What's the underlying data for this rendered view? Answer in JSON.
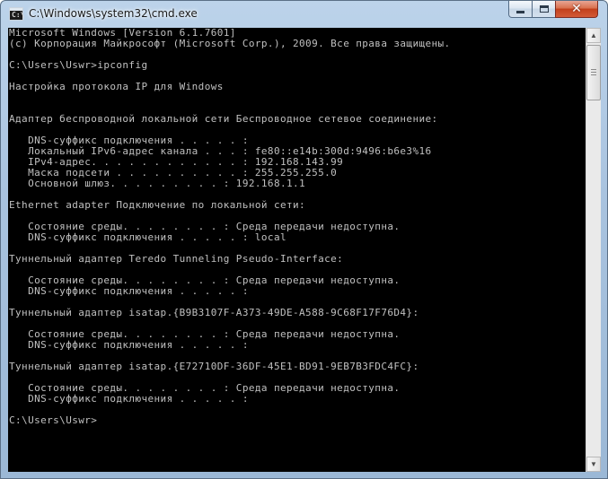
{
  "window": {
    "title": "C:\\Windows\\system32\\cmd.exe",
    "icon": "cmd-icon"
  },
  "controls": {
    "minimize_icon": "minimize-icon",
    "maximize_icon": "maximize-icon",
    "close_icon": "close-icon",
    "close_glyph": "✕"
  },
  "console": {
    "lines": [
      "Microsoft Windows [Version 6.1.7601]",
      "(c) Корпорация Майкрософт (Microsoft Corp.), 2009. Все права защищены.",
      "",
      "C:\\Users\\Uswr>ipconfig",
      "",
      "Настройка протокола IP для Windows",
      "",
      "",
      "Адаптер беспроводной локальной сети Беспроводное сетевое соединение:",
      "",
      "   DNS-суффикс подключения . . . . . :",
      "   Локальный IPv6-адрес канала . . . : fe80::e14b:300d:9496:b6e3%16",
      "   IPv4-адрес. . . . . . . . . . . . : 192.168.143.99",
      "   Маска подсети . . . . . . . . . . : 255.255.255.0",
      "   Основной шлюз. . . . . . . . . : 192.168.1.1",
      "",
      "Ethernet adapter Подключение по локальной сети:",
      "",
      "   Состояние среды. . . . . . . . : Среда передачи недоступна.",
      "   DNS-суффикс подключения . . . . . : local",
      "",
      "Туннельный адаптер Teredo Tunneling Pseudo-Interface:",
      "",
      "   Состояние среды. . . . . . . . : Среда передачи недоступна.",
      "   DNS-суффикс подключения . . . . . :",
      "",
      "Туннельный адаптер isatap.{B9B3107F-A373-49DE-A588-9C68F17F76D4}:",
      "",
      "   Состояние среды. . . . . . . . : Среда передачи недоступна.",
      "   DNS-суффикс подключения . . . . . :",
      "",
      "Туннельный адаптер isatap.{E72710DF-36DF-45E1-BD91-9EB7B3FDC4FC}:",
      "",
      "   Состояние среды. . . . . . . . : Среда передачи недоступна.",
      "   DNS-суффикс подключения . . . . . :",
      "",
      "C:\\Users\\Uswr>"
    ]
  },
  "scrollbar": {
    "up_arrow": "▲",
    "down_arrow": "▼"
  },
  "colors": {
    "console_background": "#000000",
    "console_text": "#c0c0c0",
    "close_button": "#c2401c"
  }
}
